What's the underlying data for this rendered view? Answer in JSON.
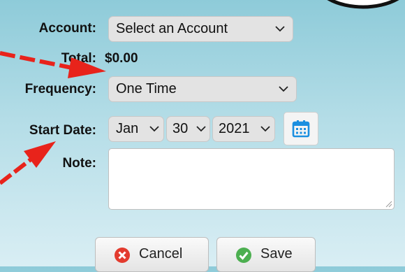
{
  "form": {
    "account_label": "Account:",
    "account_value": "Select an Account",
    "total_label": "Total:",
    "total_value": "$0.00",
    "frequency_label": "Frequency:",
    "frequency_value": "One Time",
    "start_date_label": "Start Date:",
    "start_month": "Jan",
    "start_day": "30",
    "start_year": "2021",
    "note_label": "Note:",
    "note_value": ""
  },
  "buttons": {
    "cancel_label": "Cancel",
    "save_label": "Save"
  },
  "icons": {
    "calendar": "calendar-icon",
    "cancel": "x-circle-icon",
    "save": "check-circle-icon"
  },
  "colors": {
    "annotation_red": "#e8231b",
    "calendar_blue": "#1b8fe0",
    "cancel_red": "#e33b2e",
    "save_green": "#4caf50"
  }
}
